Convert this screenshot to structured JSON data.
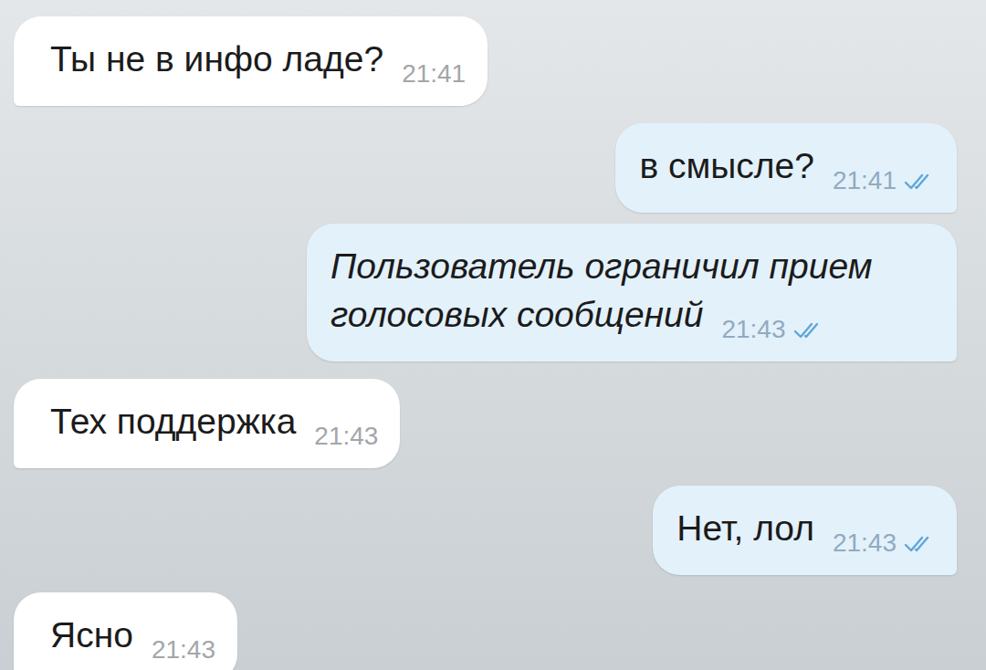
{
  "messages": [
    {
      "text": "Ты не в инфо ладе?",
      "time": "21:41",
      "kind": "incoming"
    },
    {
      "text": "в смысле?",
      "time": "21:41",
      "kind": "outgoing",
      "read": true
    },
    {
      "text": "Пользователь ограничил прием голосовых сообщений",
      "time": "21:43",
      "kind": "notice",
      "read": true
    },
    {
      "text": "Тех поддержка",
      "time": "21:43",
      "kind": "incoming"
    },
    {
      "text": "Нет, лол",
      "time": "21:43",
      "kind": "outgoing",
      "read": true
    },
    {
      "text": "Ясно",
      "time": "21:43",
      "kind": "incoming"
    }
  ]
}
